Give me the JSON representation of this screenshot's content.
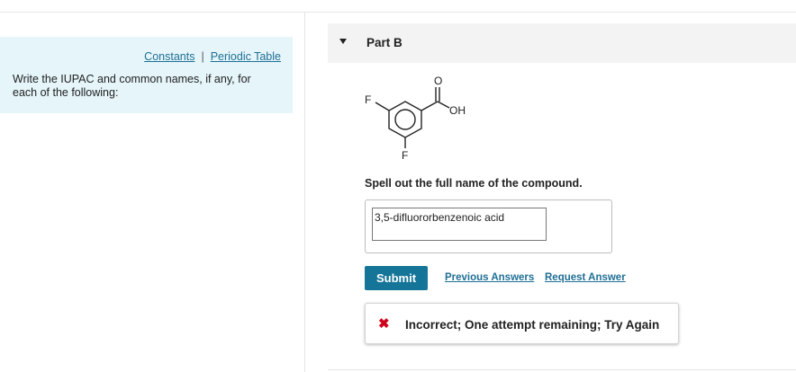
{
  "left_panel": {
    "links": [
      "Constants",
      "Periodic Table"
    ],
    "separator": "|",
    "instructions": "Write the IUPAC and common names, if any, for each of the following:"
  },
  "part": {
    "title": "Part B"
  },
  "molecule": {
    "labels": {
      "f_top": "F",
      "f_bottom": "F",
      "oh": "OH",
      "o": "O"
    }
  },
  "question": {
    "prompt": "Spell out the full name of the compound.",
    "answer_value": "3,5-difluororbenzenoic acid"
  },
  "actions": {
    "submit": "Submit",
    "previous_answers": "Previous Answers",
    "request_answer": "Request Answer"
  },
  "feedback": {
    "icon": "x-mark-icon",
    "text": "Incorrect; One attempt remaining; Try Again",
    "color": "#d0021b"
  },
  "colors": {
    "accent": "#157599",
    "link": "#1f6f95",
    "panel_bg": "#e5f5f9"
  }
}
